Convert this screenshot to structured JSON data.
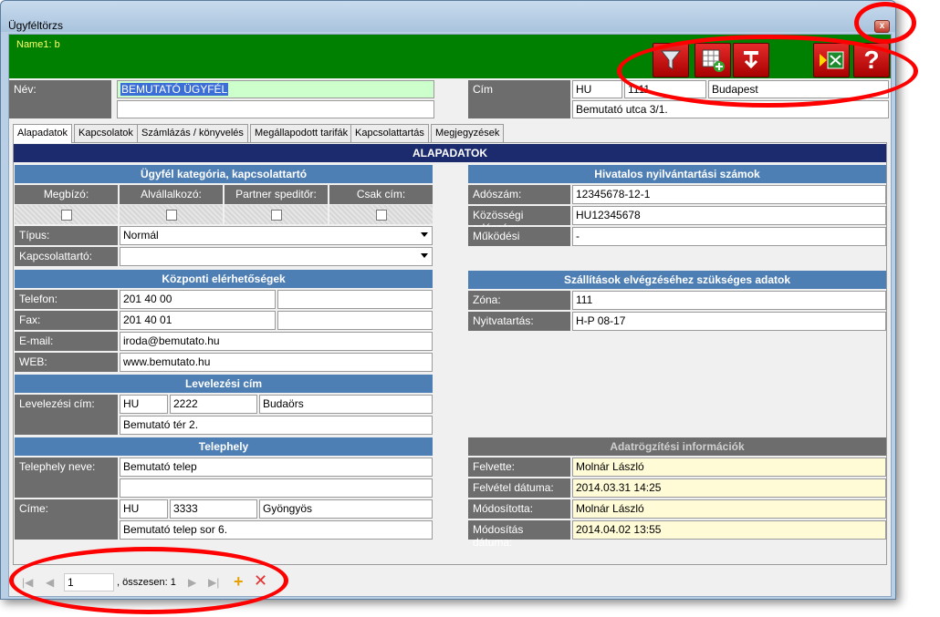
{
  "window": {
    "title": "Ügyféltörzs",
    "close_label": "x"
  },
  "header": {
    "user_label": "Name1: b",
    "toolbar": [
      {
        "name": "filter-icon",
        "symbol": "▼"
      },
      {
        "name": "grid-add-icon",
        "symbol": "▦"
      },
      {
        "name": "pin-icon",
        "symbol": "⮯"
      },
      {
        "name": "excel-export-icon",
        "symbol": "▶"
      },
      {
        "name": "help-icon",
        "symbol": "?"
      }
    ]
  },
  "top": {
    "nev_label": "Név:",
    "nev_value": "BEMUTATÓ ÜGYFÉL",
    "nev_value2": "",
    "cim_label": "Cím",
    "cim_country": "HU",
    "cim_zip": "1111",
    "cim_city": "Budapest",
    "cim_street": "Bemutató utca 3/1."
  },
  "tabs": [
    "Alapadatok",
    "Kapcsolatok",
    "Számlázás / könyvelés",
    "Megállapodott tarifák",
    "Kapcsolattartás",
    "Megjegyzések"
  ],
  "panel": {
    "title": "ALAPADATOK",
    "kategoria": {
      "title": "Ügyfél kategória, kapcsolattartó",
      "checks": [
        "Megbízó:",
        "Alvállalkozó:",
        "Partner speditőr:",
        "Csak cím:"
      ],
      "tipus_label": "Típus:",
      "tipus_value": "Normál",
      "kapcsolattarto_label": "Kapcsolattartó:",
      "kapcsolattarto_value": ""
    },
    "elerhetosegek": {
      "title": "Központi elérhetőségek",
      "telefon_label": "Telefon:",
      "telefon_value": "201 40 00",
      "fax_label": "Fax:",
      "fax_value": "201 40 01",
      "email_label": "E-mail:",
      "email_value": "iroda@bemutato.hu",
      "web_label": "WEB:",
      "web_value": "www.bemutato.hu"
    },
    "levelezesi": {
      "title": "Levelezési cím",
      "label": "Levelezési cím:",
      "country": "HU",
      "zip": "2222",
      "city": "Budaörs",
      "street": "Bemutató tér 2."
    },
    "telephely": {
      "title": "Telephely",
      "nev_label": "Telephely neve:",
      "nev_value": "Bemutató telep",
      "cime_label": "Címe:",
      "country": "HU",
      "zip": "3333",
      "city": "Gyöngyös",
      "street": "Bemutató telep sor 6."
    },
    "hivatalos": {
      "title": "Hivatalos nyilvántartási számok",
      "adoszam_label": "Adószám:",
      "adoszam_value": "12345678-12-1",
      "kozossegi_label": "Közösségi adószám:",
      "kozossegi_value": "HU12345678",
      "mukodesi_label": "Működési",
      "mukodesi_value": "-"
    },
    "szallitas": {
      "title": "Szállítások elvégzéséhez szükséges adatok",
      "zona_label": "Zóna:",
      "zona_value": "111",
      "nyitva_label": "Nyitvatartás:",
      "nyitva_value": "H-P 08-17"
    },
    "rogzites": {
      "title": "Adatrögzítési információk",
      "felvette_label": "Felvette:",
      "felvette_value": "Molnár László",
      "felvetel_label": "Felvétel dátuma:",
      "felvetel_value": "2014.03.31 14:25",
      "modositotta_label": "Módosította:",
      "modositotta_value": "Molnár László",
      "modositas_label": "Módosítás dátuma:",
      "modositas_value": "2014.04.02 13:55"
    }
  },
  "navigator": {
    "position": "1",
    "total_label": ", összesen: 1"
  },
  "colors": {
    "accent_green": "#008000",
    "section_blue": "#4e7fb4",
    "header_navy": "#1c2a6e",
    "annotation_red": "#ff0000"
  }
}
